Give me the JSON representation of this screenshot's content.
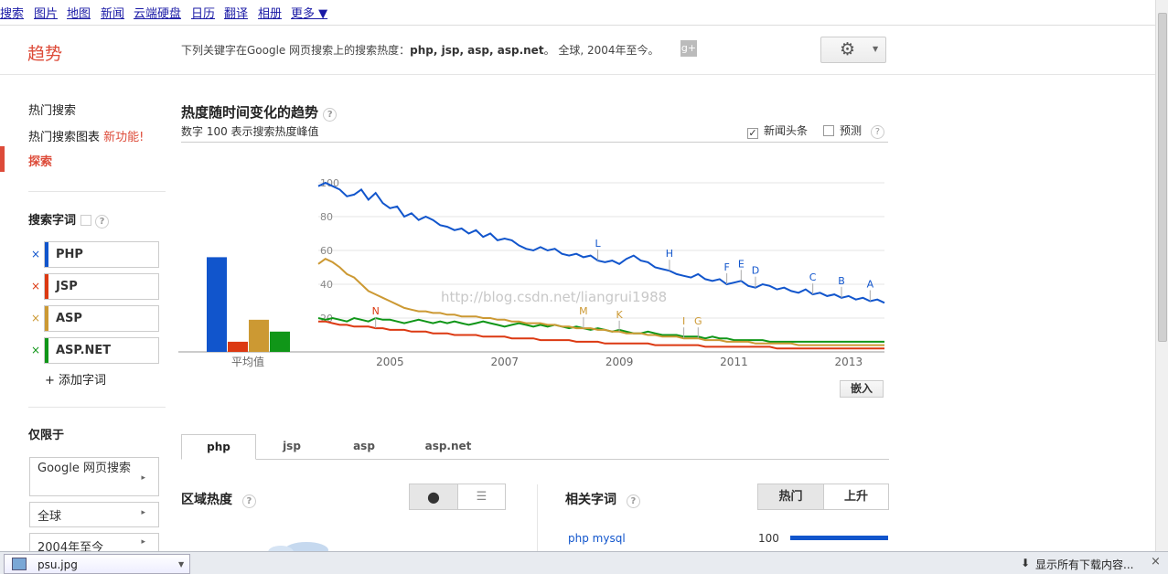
{
  "topnav": [
    "搜索",
    "图片",
    "地图",
    "新闻",
    "云端硬盘",
    "日历",
    "翻译",
    "相册",
    "更多 ▼"
  ],
  "header": {
    "brand": "趋势",
    "subtitle_prefix": "下列关键字在Google 网页搜索上的搜索热度：",
    "subtitle_terms": "php, jsp, asp, asp.net",
    "subtitle_suffix": "。 全球, 2004年至今。",
    "gplus_icon": "g-plus-icon",
    "gear_icon": "gear-icon"
  },
  "sidebar": {
    "hot_searches": "热门搜索",
    "hot_charts": "热门搜索图表",
    "new_feature": "新功能!",
    "explore": "探索",
    "search_terms_title": "搜索字词",
    "add_term": "添加字词",
    "limit_title": "仅限于",
    "filters": [
      "Google 网页搜索",
      "全球",
      "2004年至今"
    ]
  },
  "terms": [
    {
      "label": "PHP",
      "color": "#1155cc"
    },
    {
      "label": "JSP",
      "color": "#dc3912"
    },
    {
      "label": "ASP",
      "color": "#cc9933"
    },
    {
      "label": "ASP.NET",
      "color": "#109618"
    }
  ],
  "main": {
    "title": "热度随时间变化的趋势",
    "subtitle": "数字 100 表示搜索热度峰值",
    "news_headlines": "新闻头条",
    "forecast": "预测",
    "embed": "嵌入",
    "tabs": [
      "php",
      "jsp",
      "asp",
      "asp.net"
    ],
    "region_title": "区域热度",
    "related_title": "相关字词",
    "related_buttons": [
      "热门",
      "上升"
    ],
    "related_rows": [
      {
        "term": "php mysql",
        "value": "100"
      }
    ]
  },
  "chart_data": {
    "type": "line",
    "average_bars": {
      "label": "平均值",
      "values": [
        56,
        6,
        19,
        12
      ]
    },
    "x_ticks": [
      "2005",
      "2007",
      "2009",
      "2011",
      "2013"
    ],
    "y_ticks": [
      20,
      40,
      60,
      80,
      100
    ],
    "ylim": [
      0,
      100
    ],
    "watermark": "http://blog.csdn.net/liangrui1988",
    "series": [
      {
        "values": [
          98,
          100,
          98,
          96,
          92,
          93,
          96,
          90,
          94,
          88,
          85,
          86,
          80,
          82,
          78,
          80,
          78,
          75,
          74,
          72,
          73,
          70,
          72,
          68,
          70,
          66,
          67,
          66,
          63,
          61,
          60,
          62,
          60,
          61,
          58,
          57,
          58,
          56,
          57,
          54,
          53,
          54,
          52,
          55,
          57,
          54,
          53,
          50,
          49,
          48,
          46,
          45,
          44,
          46,
          43,
          42,
          43,
          40,
          41,
          42,
          39,
          38,
          40,
          39,
          37,
          38,
          36,
          35,
          37,
          34,
          35,
          33,
          34,
          32,
          33,
          31,
          32,
          30,
          31,
          29
        ]
      },
      {
        "values": [
          18,
          18,
          17,
          16,
          16,
          15,
          15,
          15,
          14,
          14,
          13,
          13,
          13,
          12,
          12,
          12,
          11,
          11,
          11,
          10,
          10,
          10,
          10,
          9,
          9,
          9,
          9,
          8,
          8,
          8,
          8,
          7,
          7,
          7,
          7,
          7,
          6,
          6,
          6,
          6,
          5,
          5,
          5,
          5,
          5,
          5,
          5,
          4,
          4,
          4,
          4,
          4,
          4,
          4,
          3,
          3,
          3,
          3,
          3,
          3,
          3,
          3,
          3,
          3,
          2,
          2,
          2,
          2,
          2,
          2,
          2,
          2,
          2,
          2,
          2,
          2,
          2,
          2,
          2,
          2
        ]
      },
      {
        "values": [
          52,
          55,
          53,
          50,
          46,
          44,
          40,
          36,
          34,
          32,
          30,
          28,
          26,
          25,
          24,
          24,
          23,
          23,
          22,
          22,
          21,
          21,
          21,
          20,
          20,
          19,
          19,
          18,
          18,
          17,
          17,
          17,
          16,
          16,
          15,
          15,
          14,
          14,
          14,
          13,
          13,
          12,
          12,
          11,
          11,
          11,
          10,
          10,
          9,
          9,
          9,
          8,
          8,
          8,
          7,
          7,
          7,
          6,
          6,
          6,
          6,
          5,
          5,
          5,
          5,
          5,
          5,
          4,
          4,
          4,
          4,
          4,
          4,
          4,
          4,
          4,
          4,
          4,
          4,
          4
        ]
      },
      {
        "values": [
          20,
          19,
          20,
          19,
          18,
          20,
          19,
          18,
          20,
          19,
          19,
          18,
          17,
          18,
          19,
          18,
          17,
          18,
          17,
          18,
          17,
          16,
          17,
          18,
          17,
          16,
          15,
          16,
          17,
          16,
          15,
          16,
          15,
          16,
          15,
          14,
          15,
          14,
          13,
          14,
          13,
          12,
          13,
          12,
          11,
          11,
          12,
          11,
          10,
          10,
          10,
          9,
          9,
          9,
          8,
          9,
          8,
          8,
          7,
          7,
          7,
          7,
          7,
          6,
          6,
          6,
          6,
          6,
          6,
          6,
          6,
          6,
          6,
          6,
          6,
          6,
          6,
          6,
          6,
          6
        ]
      }
    ],
    "annotations": [
      {
        "label": "L",
        "series": 0,
        "x_index": 39
      },
      {
        "label": "H",
        "series": 0,
        "x_index": 49
      },
      {
        "label": "F",
        "series": 0,
        "x_index": 57
      },
      {
        "label": "E",
        "series": 0,
        "x_index": 59
      },
      {
        "label": "D",
        "series": 0,
        "x_index": 61
      },
      {
        "label": "C",
        "series": 0,
        "x_index": 69
      },
      {
        "label": "B",
        "series": 0,
        "x_index": 73
      },
      {
        "label": "A",
        "series": 0,
        "x_index": 77
      },
      {
        "label": "N",
        "series": 1,
        "x_index": 8
      },
      {
        "label": "M",
        "series": 2,
        "x_index": 37
      },
      {
        "label": "K",
        "series": 2,
        "x_index": 42
      },
      {
        "label": "I",
        "series": 2,
        "x_index": 51
      },
      {
        "label": "G",
        "series": 2,
        "x_index": 53
      }
    ]
  },
  "bottombar": {
    "file": "psu.jpg",
    "show_all": "显示所有下载内容..."
  }
}
